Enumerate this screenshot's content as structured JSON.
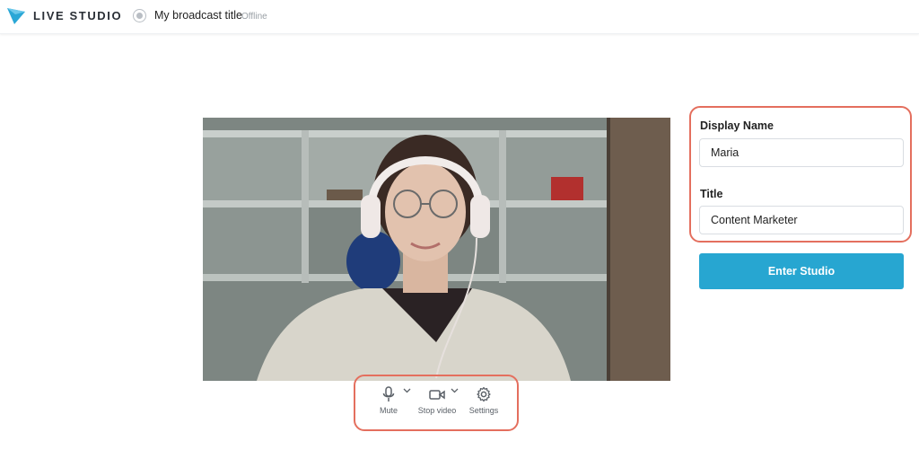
{
  "header": {
    "brand": "LIVE STUDIO",
    "broadcast_title": "My broadcast title",
    "status": "Offline"
  },
  "controls": {
    "mute_label": "Mute",
    "stop_video_label": "Stop video",
    "settings_label": "Settings"
  },
  "form": {
    "display_name_label": "Display Name",
    "display_name_value": "Maria",
    "title_label": "Title",
    "title_value": "Content Marketer",
    "enter_button": "Enter Studio"
  },
  "colors": {
    "accent": "#27a6d1",
    "highlight": "#e46f5e"
  },
  "icons": {
    "logo": "play-triangle-logo",
    "status": "status-dot",
    "mute": "microphone-icon",
    "video": "video-camera-icon",
    "settings": "gear-icon",
    "dropdown": "chevron-down-icon"
  }
}
